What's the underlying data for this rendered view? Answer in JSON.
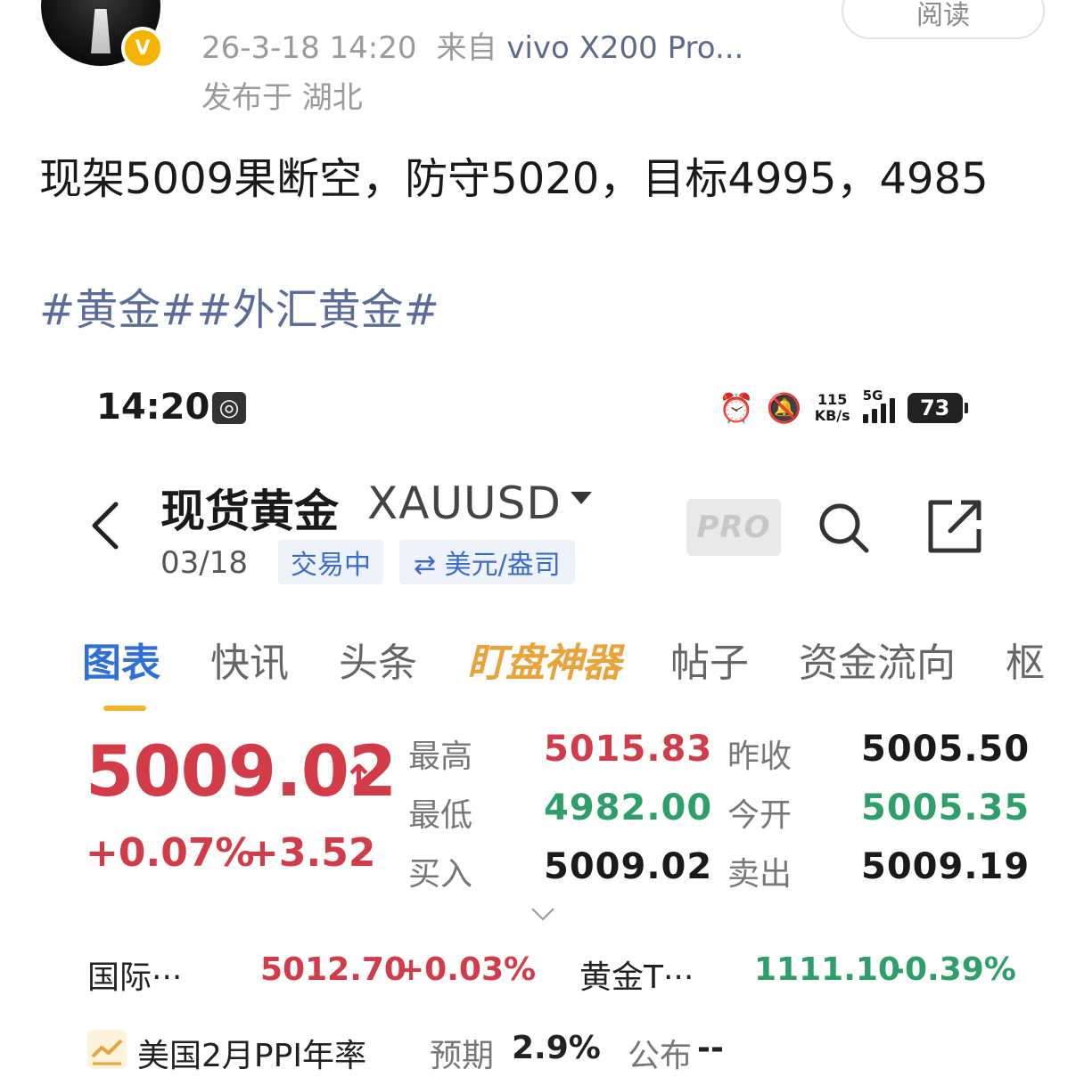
{
  "post": {
    "timestamp": "26-3-18 14:20",
    "source_prefix": "来自",
    "source_device": "vivo X200 Pro...",
    "location": "发布于 湖北",
    "read_label": "阅读",
    "text": "现架5009果断空，防守5020，目标4995，4985",
    "hashtags": "#黄金##外汇黄金#",
    "verified_badge": "V"
  },
  "phone": {
    "status": {
      "time": "14:20",
      "speed_top": "115",
      "speed_bottom": "KB/s",
      "network": "5G",
      "battery": "73"
    },
    "header": {
      "title": "现货黄金",
      "symbol": "XAUUSD",
      "date": "03/18",
      "trading_status": "交易中",
      "unit": "⇄ 美元/盎司",
      "pro_label": "PRO"
    },
    "tabs": [
      "图表",
      "快讯",
      "头条",
      "盯盘神器",
      "帖子",
      "资金流向",
      "枢"
    ],
    "quote": {
      "price": "5009.02",
      "arrow": "↑",
      "change_pct": "+0.07%",
      "change_abs": "+3.52",
      "high_label": "最高",
      "high": "5015.83",
      "low_label": "最低",
      "low": "4982.00",
      "bid_label": "买入",
      "bid": "5009.02",
      "prev_close_label": "昨收",
      "prev_close": "5005.50",
      "open_label": "今开",
      "open": "5005.35",
      "ask_label": "卖出",
      "ask": "5009.19"
    },
    "related": [
      {
        "name": "国际···",
        "price": "5012.70",
        "change": "+0.03%"
      },
      {
        "name": "黄金T···",
        "price": "1111.10",
        "change": "-0.39%"
      }
    ],
    "event": {
      "name": "美国2月PPI年率",
      "expected_label": "预期",
      "expected_value": "2.9%",
      "actual_label": "公布",
      "actual_value": "--"
    }
  },
  "colors": {
    "up": "#d23b48",
    "down": "#2e9e6a",
    "accent": "#2f6fd6",
    "link": "#5b6b9a"
  }
}
